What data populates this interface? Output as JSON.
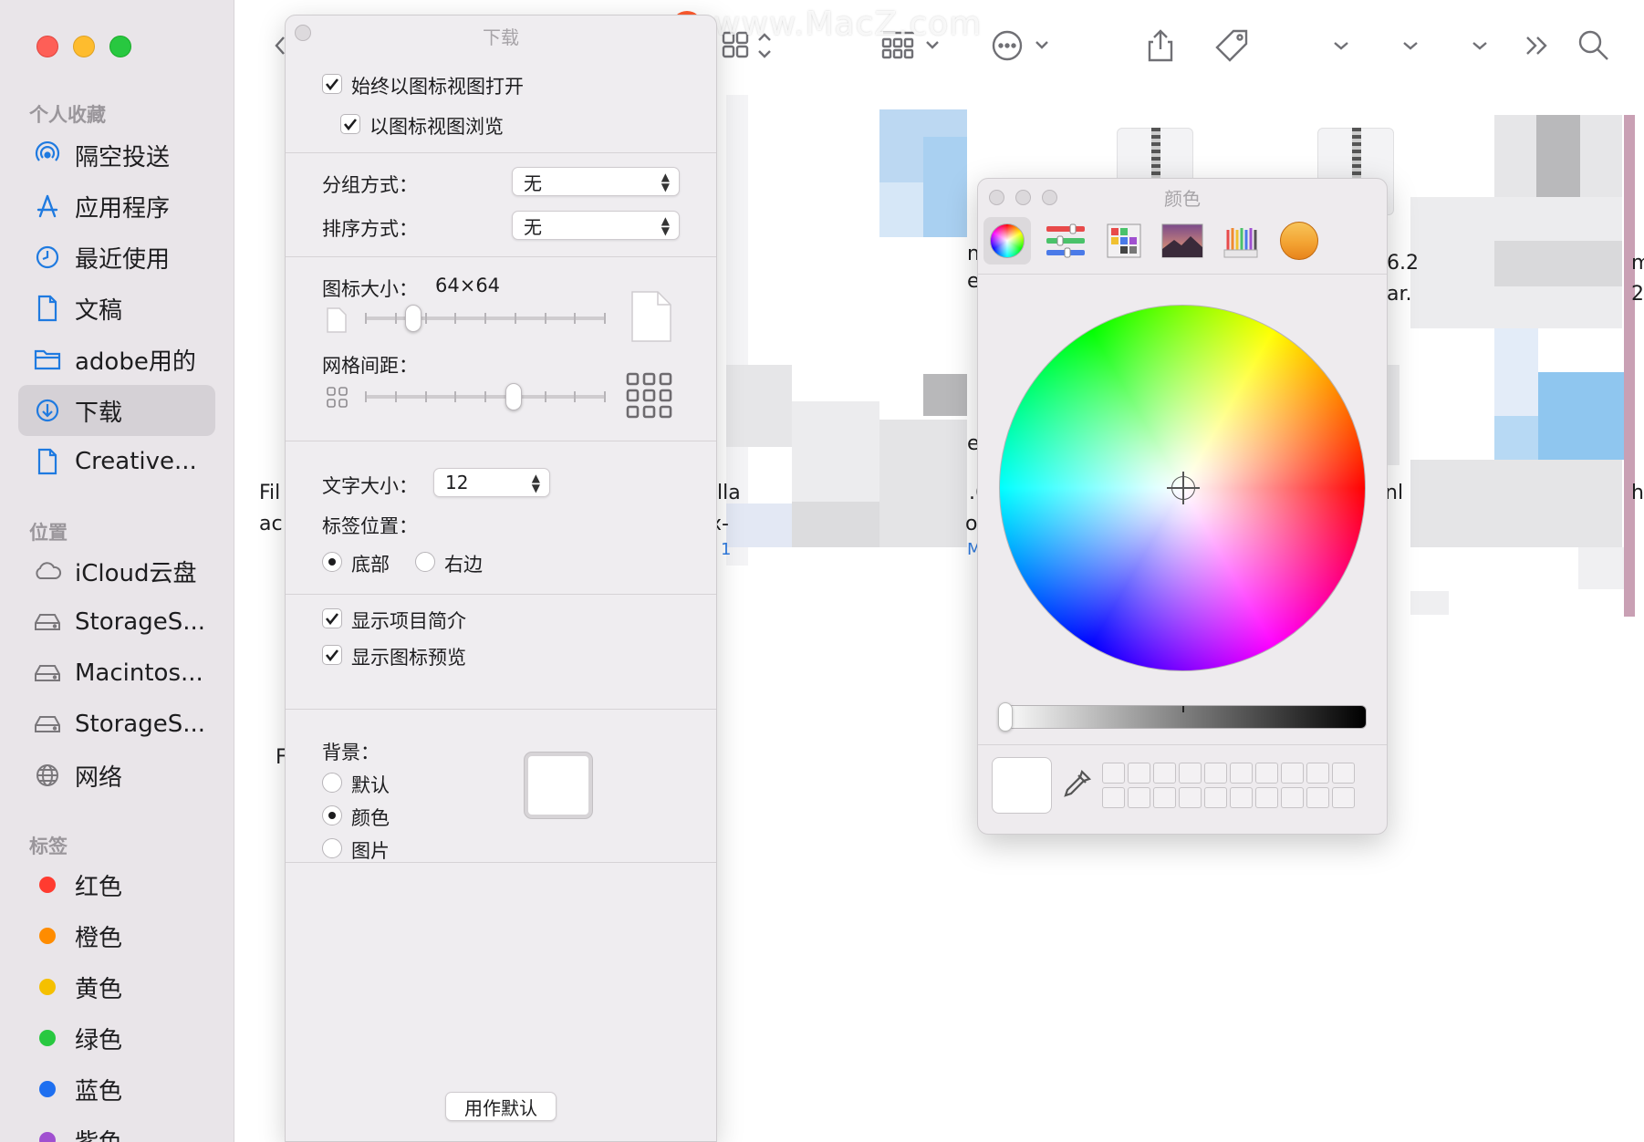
{
  "sidebar": {
    "favorites_header": "个人收藏",
    "favorites": [
      {
        "label": "隔空投送",
        "icon": "airdrop-icon"
      },
      {
        "label": "应用程序",
        "icon": "applications-icon"
      },
      {
        "label": "最近使用",
        "icon": "recents-icon"
      },
      {
        "label": "文稿",
        "icon": "document-icon"
      },
      {
        "label": "adobe用的",
        "icon": "folder-icon"
      },
      {
        "label": "下载",
        "icon": "downloads-icon",
        "selected": true
      },
      {
        "label": "Creative...",
        "icon": "file-icon"
      }
    ],
    "locations_header": "位置",
    "locations": [
      {
        "label": "iCloud云盘",
        "icon": "icloud-icon"
      },
      {
        "label": "StorageS...",
        "icon": "drive-icon"
      },
      {
        "label": "Macintos...",
        "icon": "drive-icon"
      },
      {
        "label": "StorageS...",
        "icon": "drive-icon"
      },
      {
        "label": "网络",
        "icon": "network-icon"
      }
    ],
    "tags_header": "标签",
    "tags": [
      {
        "label": "红色",
        "color": "#ff3b30"
      },
      {
        "label": "橙色",
        "color": "#ff8c00"
      },
      {
        "label": "黄色",
        "color": "#f5c000"
      },
      {
        "label": "绿色",
        "color": "#28c840"
      },
      {
        "label": "蓝色",
        "color": "#1e6ff0"
      },
      {
        "label": "紫色",
        "color": "#a050d0"
      }
    ]
  },
  "toolbar": {
    "icons": [
      "back-icon",
      "icon-view-icon",
      "group-icon",
      "more-icon",
      "share-icon",
      "tag-icon",
      "chevron-down-icon",
      "chevron-down-icon",
      "chevron-down-icon",
      "overflow-icon",
      "search-icon"
    ]
  },
  "watermark": {
    "logo": "Z",
    "text": "www.MacZ.com"
  },
  "background_fragments": [
    "Fil",
    "ac",
    "lla",
    "x-",
    "1",
    ".6",
    "o.",
    "M",
    "6.2",
    "ar.",
    "nl",
    "m",
    "2",
    "F",
    "n",
    "e",
    "e",
    "hc"
  ],
  "view_options": {
    "title": "下载",
    "always_open_icon_view": {
      "label": "始终以图标视图打开",
      "checked": true
    },
    "browse_icon_view": {
      "label": "以图标视图浏览",
      "checked": true
    },
    "group_by": {
      "label": "分组方式：",
      "value": "无"
    },
    "sort_by": {
      "label": "排序方式：",
      "value": "无"
    },
    "icon_size": {
      "label": "图标大小：",
      "value": "64×64",
      "level": 0.2
    },
    "grid_spacing": {
      "label": "网格间距：",
      "level": 0.62
    },
    "text_size": {
      "label": "文字大小：",
      "value": "12"
    },
    "label_position": {
      "label": "标签位置：",
      "options": [
        "底部",
        "右边"
      ],
      "selected": "底部"
    },
    "show_item_info": {
      "label": "显示项目简介",
      "checked": true
    },
    "show_icon_preview": {
      "label": "显示图标预览",
      "checked": true
    },
    "background": {
      "label": "背景：",
      "options": [
        "默认",
        "颜色",
        "图片"
      ],
      "selected": "颜色",
      "color": "#ffffff"
    },
    "use_as_defaults": "用作默认"
  },
  "colors_panel": {
    "title": "颜色",
    "tabs": [
      "color-wheel-icon",
      "color-sliders-icon",
      "color-palettes-icon",
      "image-palettes-icon",
      "pencils-icon",
      "sampler-icon"
    ],
    "active_tab": "color-wheel-icon",
    "brightness": 1.0,
    "current_color": "#ffffff"
  }
}
